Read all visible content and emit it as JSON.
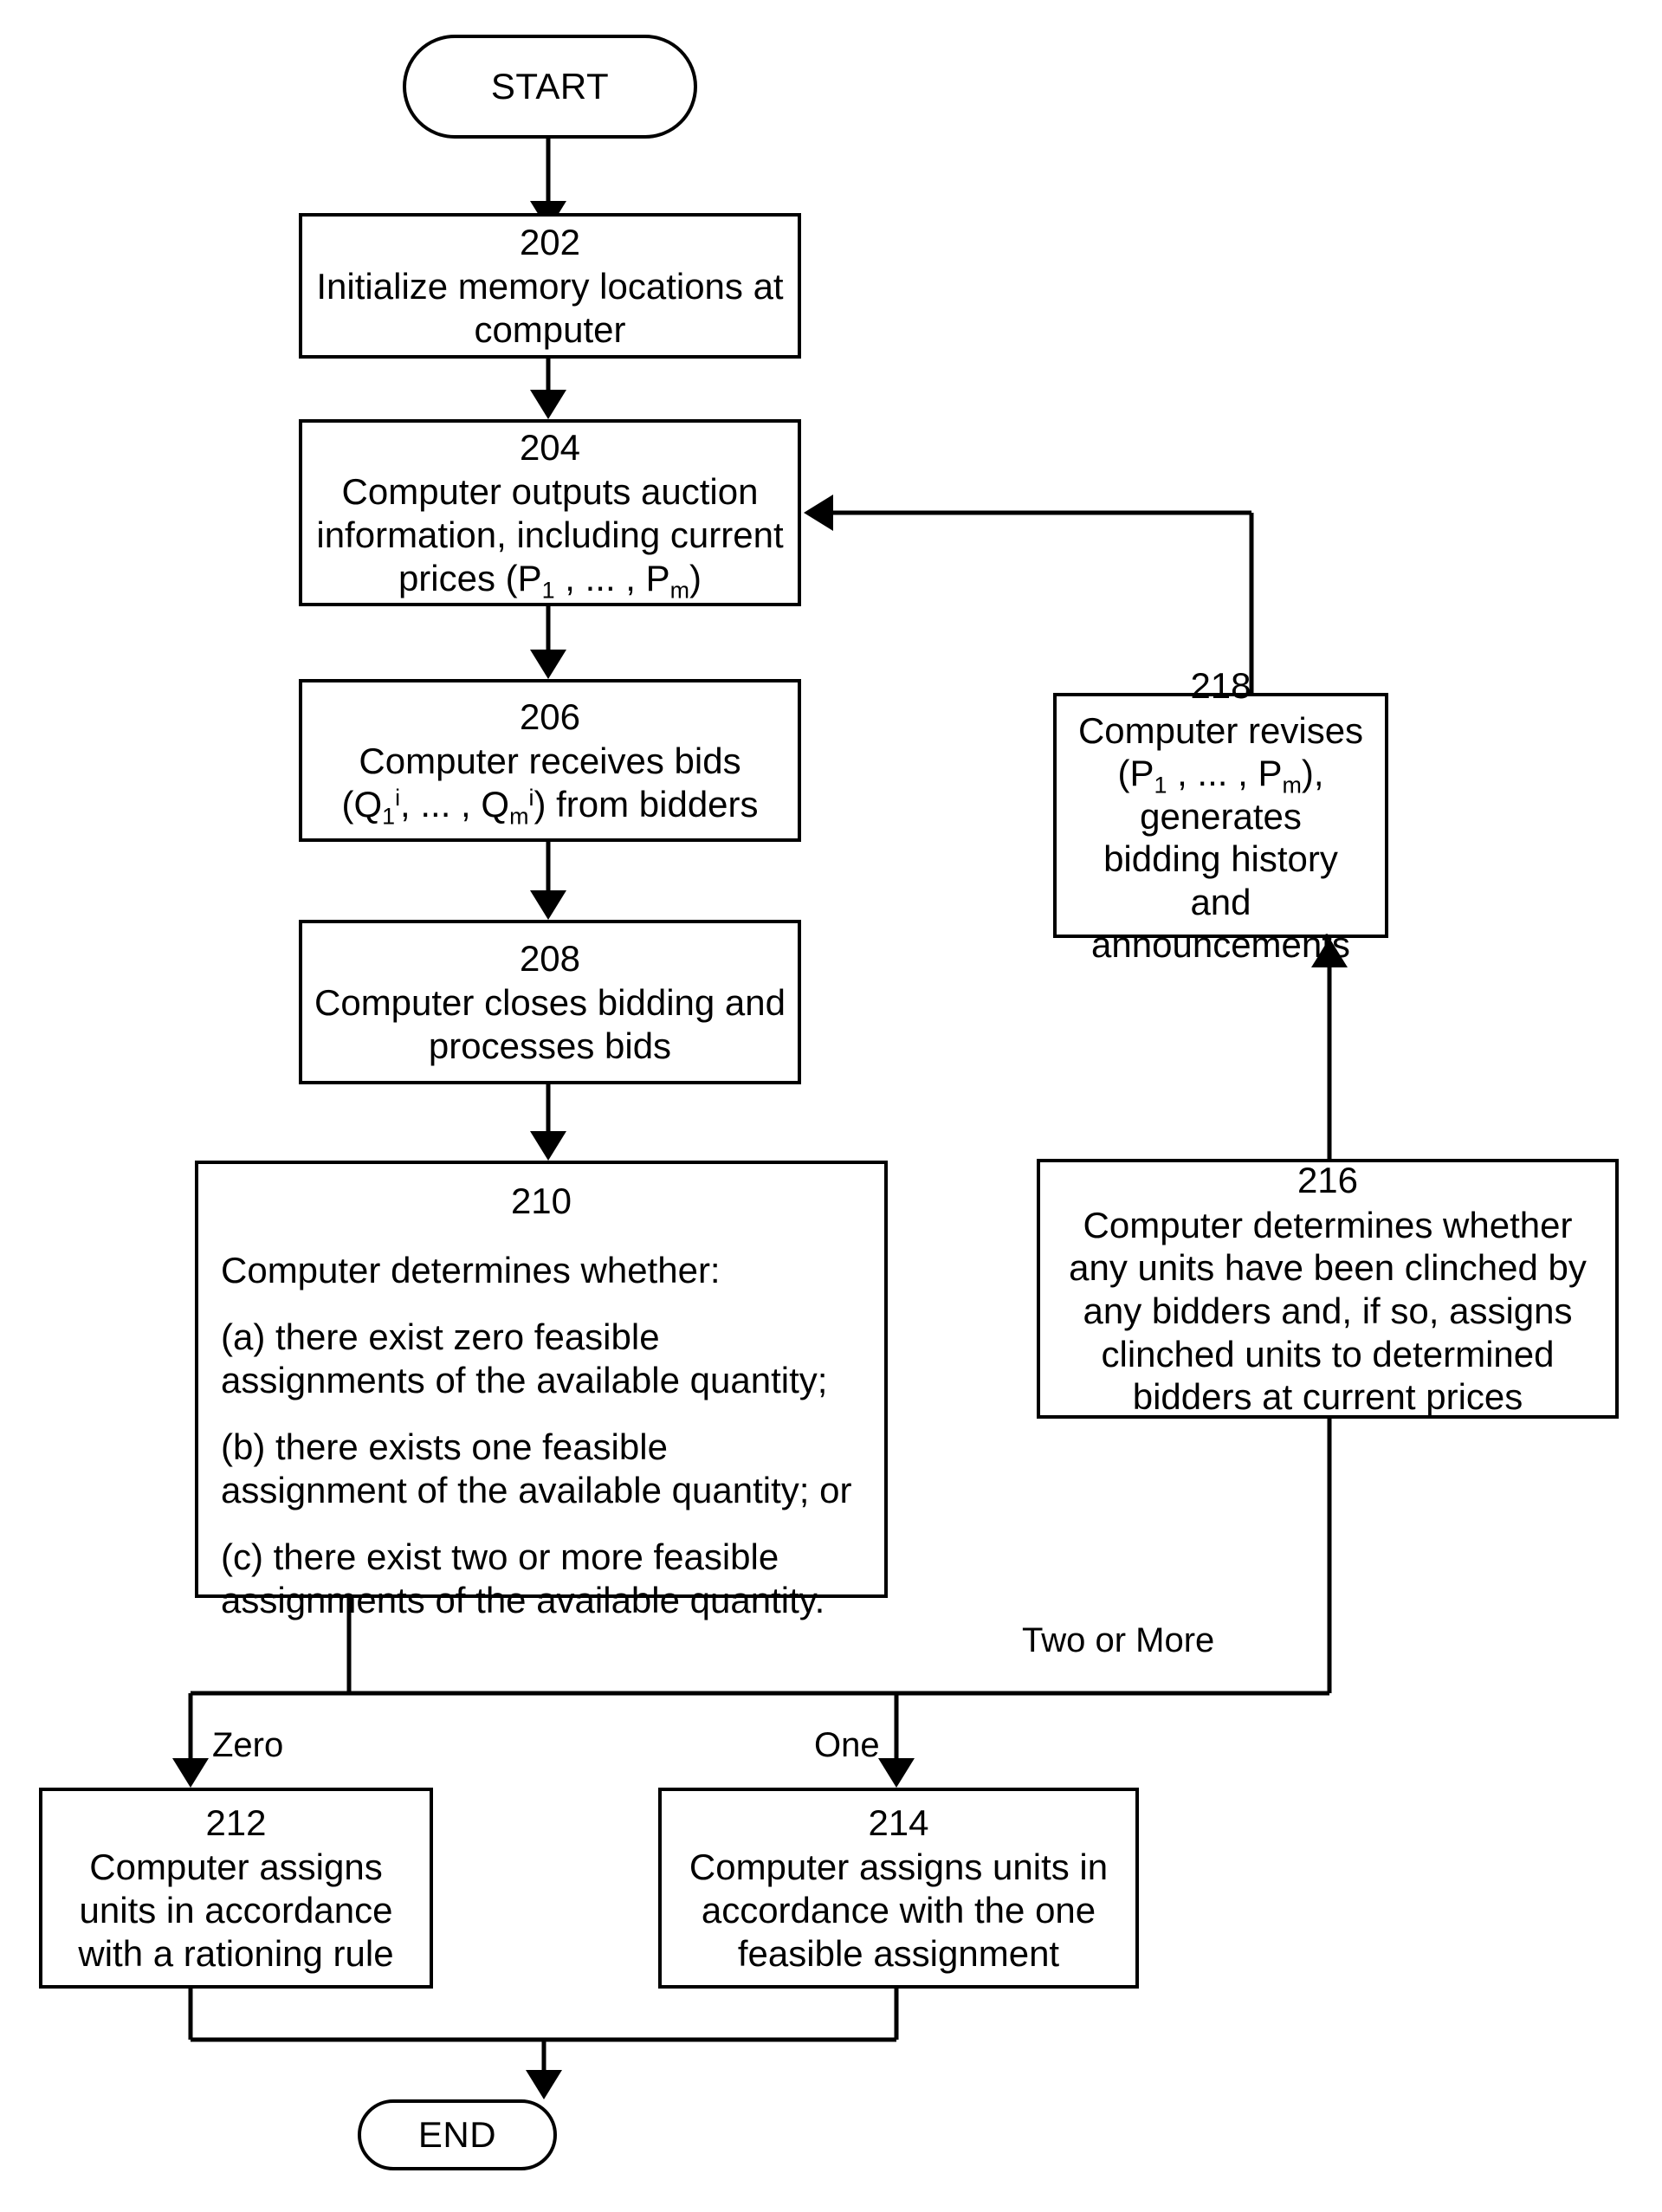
{
  "figure": {
    "type": "flowchart",
    "orientation": "vertical-with-feedback-loop",
    "line_color": "#000000",
    "background_color": "#ffffff"
  },
  "nodes": {
    "start": {
      "shape": "terminator",
      "label": "START"
    },
    "end": {
      "shape": "terminator",
      "label": "END"
    },
    "step202": {
      "ref": "202",
      "text": "Initialize memory locations at computer"
    },
    "step204": {
      "ref": "204",
      "line1": "Computer outputs auction",
      "line2": "information, including current",
      "line3_prefix": "prices (P",
      "line3_sub1": "1",
      "line3_mid": " , ... , P",
      "line3_sub2": "m",
      "line3_suffix": ")"
    },
    "step206": {
      "ref": "206",
      "line1": "Computer receives bids",
      "line2_open": "(Q",
      "line2_sub1": "1",
      "line2_sup1": "i",
      "line2_mid": ", ... , Q",
      "line2_sub2": "m",
      "line2_sup2": "i",
      "line2_close": ") from bidders"
    },
    "step208": {
      "ref": "208",
      "text": "Computer closes bidding and processes bids"
    },
    "step210": {
      "ref": "210",
      "intro": "Computer determines whether:",
      "option_a": "(a) there exist zero feasible assignments of the available quantity;",
      "option_b": "(b) there exists one feasible assignment of the available quantity; or",
      "option_c": "(c) there exist two or more feasible assignments of the available quantity."
    },
    "step212": {
      "ref": "212",
      "text": "Computer assigns units in accordance with a rationing rule"
    },
    "step214": {
      "ref": "214",
      "text": "Computer assigns units in accordance with the one feasible assignment"
    },
    "step216": {
      "ref": "216",
      "text": "Computer determines whether any units have been clinched by any bidders and, if so, assigns clinched units to determined bidders at current prices"
    },
    "step218": {
      "ref": "218",
      "line1": "Computer revises",
      "line2_open": "(P",
      "line2_sub1": "1",
      "line2_mid": " , ... , P",
      "line2_sub2": "m",
      "line2_close": "), generates",
      "line3": "bidding history and",
      "line4": "announcements"
    }
  },
  "edge_labels": {
    "zero": "Zero",
    "one": "One",
    "two_or_more": "Two or More"
  }
}
